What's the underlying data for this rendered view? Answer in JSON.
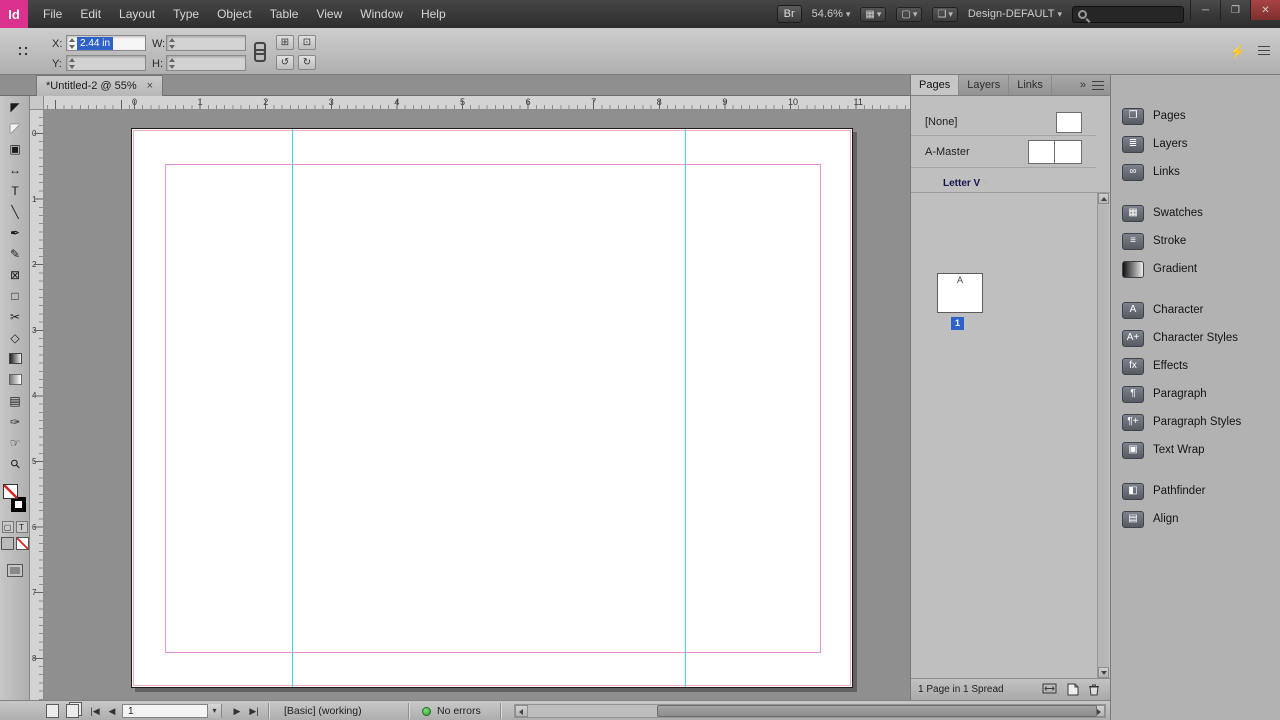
{
  "menubar": {
    "logo_text": "Id",
    "menus": [
      "File",
      "Edit",
      "Layout",
      "Type",
      "Object",
      "Table",
      "View",
      "Window",
      "Help"
    ],
    "bridge_button": "Br",
    "zoom_value": "54.6%",
    "workspace_name": "Design-DEFAULT",
    "search_value": ""
  },
  "window_controls": {
    "minimize": "─",
    "restore": "❐",
    "close": "✕"
  },
  "controlbar": {
    "x_label": "X:",
    "x_value": "2.44 in",
    "y_label": "Y:",
    "y_value": "",
    "w_label": "W:",
    "w_value": "",
    "h_label": "H:",
    "h_value": ""
  },
  "document_tab": {
    "title": "*Untitled-2 @ 55%",
    "close_glyph": "×"
  },
  "rulers": {
    "horizontal": [
      "0",
      "1",
      "2",
      "3",
      "4",
      "5",
      "6",
      "7",
      "8",
      "9",
      "10",
      "11"
    ],
    "vertical": [
      "0",
      "1",
      "2",
      "3",
      "4",
      "5",
      "6",
      "7",
      "8"
    ]
  },
  "toolbar": {
    "tools": [
      {
        "name": "selection-tool",
        "glyph": "◤"
      },
      {
        "name": "direct-selection-tool",
        "glyph": "◤",
        "kind": "outline"
      },
      {
        "name": "page-tool",
        "glyph": "▣"
      },
      {
        "name": "gap-tool",
        "glyph": "↔"
      },
      {
        "name": "type-tool",
        "glyph": "T"
      },
      {
        "name": "line-tool",
        "glyph": "╲"
      },
      {
        "name": "pen-tool",
        "glyph": "✒"
      },
      {
        "name": "pencil-tool",
        "glyph": "✎"
      },
      {
        "name": "rectangle-frame-tool",
        "glyph": "⊠"
      },
      {
        "name": "rectangle-tool",
        "glyph": "□"
      },
      {
        "name": "scissors-tool",
        "glyph": "✂"
      },
      {
        "name": "free-transform-tool",
        "glyph": "◇"
      },
      {
        "name": "gradient-swatch-tool",
        "glyph": "",
        "kind": "gradient"
      },
      {
        "name": "gradient-feather-tool",
        "glyph": "",
        "kind": "gradient2"
      },
      {
        "name": "note-tool",
        "glyph": "▤"
      },
      {
        "name": "eyedropper-tool",
        "glyph": "✑"
      },
      {
        "name": "hand-tool",
        "glyph": "☞"
      },
      {
        "name": "zoom-tool",
        "glyph": "⚲",
        "rotate": -45
      }
    ]
  },
  "pages_panel": {
    "tabs": [
      {
        "label": "Pages",
        "active": true
      },
      {
        "label": "Layers",
        "active": false
      },
      {
        "label": "Links",
        "active": false
      }
    ],
    "none_label": "[None]",
    "master_label": "A-Master",
    "size_preset": "Letter V",
    "master_letter": "A",
    "page_number": "1",
    "status_text": "1 Page in 1 Spread"
  },
  "dock": {
    "items": [
      {
        "label": "Pages",
        "glyph": "❐"
      },
      {
        "label": "Layers",
        "glyph": "≣"
      },
      {
        "label": "Links",
        "glyph": "∞"
      },
      {
        "label": "Swatches",
        "glyph": "▦",
        "gap_before": true
      },
      {
        "label": "Stroke",
        "glyph": "≡"
      },
      {
        "label": "Gradient",
        "glyph": "",
        "kind": "gradient"
      },
      {
        "label": "Character",
        "glyph": "A",
        "gap_before": true
      },
      {
        "label": "Character Styles",
        "glyph": "A+"
      },
      {
        "label": "Effects",
        "glyph": "fx"
      },
      {
        "label": "Paragraph",
        "glyph": "¶"
      },
      {
        "label": "Paragraph Styles",
        "glyph": "¶+"
      },
      {
        "label": "Text Wrap",
        "glyph": "▣"
      },
      {
        "label": "Pathfinder",
        "glyph": "◧",
        "gap_before": true
      },
      {
        "label": "Align",
        "glyph": "▤"
      }
    ]
  },
  "statusbar": {
    "page_value": "1",
    "preflight_profile": "[Basic] (working)",
    "error_status": "No errors"
  },
  "colors": {
    "brand_pink": "#d9328c",
    "margin_guide": "#ee8fd9",
    "column_guide": "#3fd6ea",
    "page_edge_highlight": "#e14b63",
    "selection_blue": "#2e62c9",
    "error_green": "#3cb43c"
  }
}
